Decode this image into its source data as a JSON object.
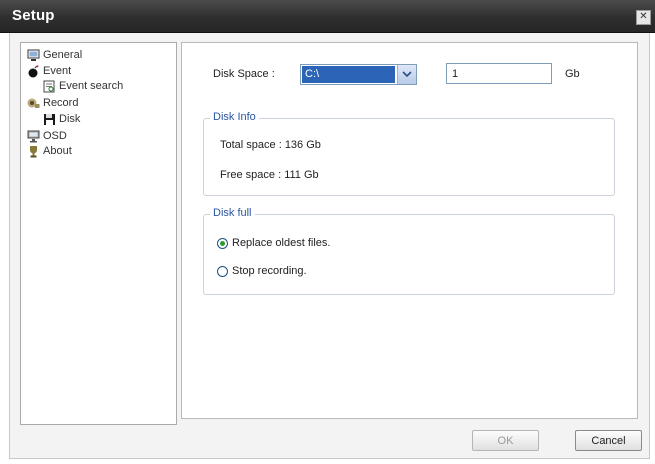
{
  "window": {
    "title": "Setup"
  },
  "tree": {
    "items": [
      {
        "label": "General",
        "icon": "monitor-icon"
      },
      {
        "label": "Event",
        "icon": "bomb-icon"
      },
      {
        "label": "Event search",
        "icon": "search-doc-icon"
      },
      {
        "label": "Record",
        "icon": "camera-icon"
      },
      {
        "label": "Disk",
        "icon": "floppy-disk-icon"
      },
      {
        "label": "OSD",
        "icon": "display-icon"
      },
      {
        "label": "About",
        "icon": "trophy-icon"
      }
    ]
  },
  "disk": {
    "label": "Disk Space :",
    "drive_value": "C:\\",
    "size_value": "1",
    "unit": "Gb"
  },
  "disk_info": {
    "legend": "Disk Info",
    "total": "Total space : 136 Gb",
    "free": "Free space : 111 Gb"
  },
  "disk_full": {
    "legend": "Disk full",
    "options": [
      {
        "label": "Replace oldest files.",
        "selected": true
      },
      {
        "label": "Stop recording.",
        "selected": false
      }
    ]
  },
  "buttons": {
    "ok": "OK",
    "cancel": "Cancel"
  },
  "colors": {
    "titlebar": "#2f2f2f",
    "selection": "#2c64b8",
    "legend": "#2a55a0"
  }
}
